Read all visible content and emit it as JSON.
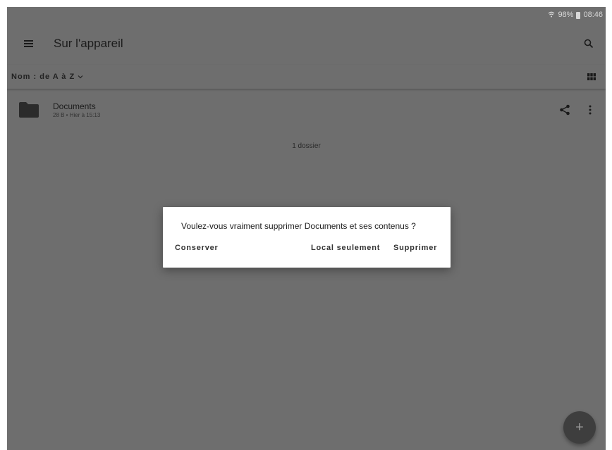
{
  "status_bar": {
    "battery": "98%",
    "time": "08:46"
  },
  "app_bar": {
    "title": "Sur l'appareil"
  },
  "sort_bar": {
    "label": "Nom : de A à Z"
  },
  "files": [
    {
      "name": "Documents",
      "meta": "28 B • Hier à 15:13"
    }
  ],
  "folder_count": "1 dossier",
  "dialog": {
    "message": "Voulez-vous vraiment supprimer Documents et ses contenus ?",
    "buttons": {
      "keep": "Conserver",
      "local_only": "Local seulement",
      "delete": "Supprimer"
    }
  },
  "fab": {
    "label": "+"
  },
  "icons": {
    "menu": "menu-icon",
    "search": "search-icon",
    "grid": "grid-view-icon",
    "folder": "folder-icon",
    "share": "share-icon",
    "more": "more-vert-icon",
    "add": "plus-icon"
  },
  "colors": {
    "scrim_background": "#6e6e6e",
    "dialog_background": "#ffffff",
    "fab_background": "#3e3e3e"
  }
}
